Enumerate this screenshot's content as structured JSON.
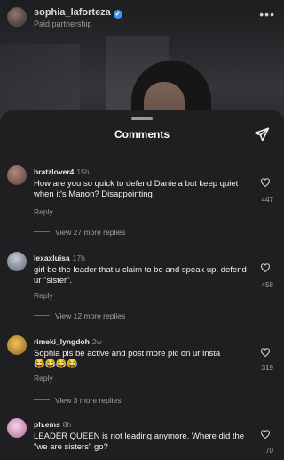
{
  "post": {
    "username": "sophia_laforteza",
    "subtitle": "Paid partnership"
  },
  "sheet": {
    "title": "Comments"
  },
  "comments": [
    {
      "username": "bratzlover4",
      "time": "15h",
      "text": "How are you so quick to defend Daniela but keep quiet when it's Manon? Disappointing.",
      "reply_label": "Reply",
      "likes": "447",
      "view_replies": "View 27 more replies",
      "avatar_color": "#7d5a4f"
    },
    {
      "username": "lexaxluisa",
      "time": "17h",
      "text": "girl be the leader that u claim to be and speak up. defend ur \"sister\".",
      "reply_label": "Reply",
      "likes": "458",
      "view_replies": "View 12 more replies",
      "avatar_color": "#8a90a0"
    },
    {
      "username": "rimeki_lyngdoh",
      "time": "2w",
      "text": "Sophia pls be active and post more pic on ur insta",
      "emojis": "😂😂😂😂",
      "reply_label": "Reply",
      "likes": "319",
      "view_replies": "View 3 more replies",
      "avatar_color": "#c99a3b"
    },
    {
      "username": "ph.ems",
      "time": "8h",
      "text": "LEADER QUEEN is not leading anymore. Where did the \"we are sisters\" go?",
      "likes": "70",
      "avatar_color": "#d9a8c8"
    }
  ],
  "colors": {
    "sheet_bg": "#1f1f21",
    "accent_verified": "#3897f0"
  },
  "icons": {
    "share": "paper-plane-icon",
    "like": "heart-outline-icon",
    "more": "more-horizontal-icon"
  }
}
